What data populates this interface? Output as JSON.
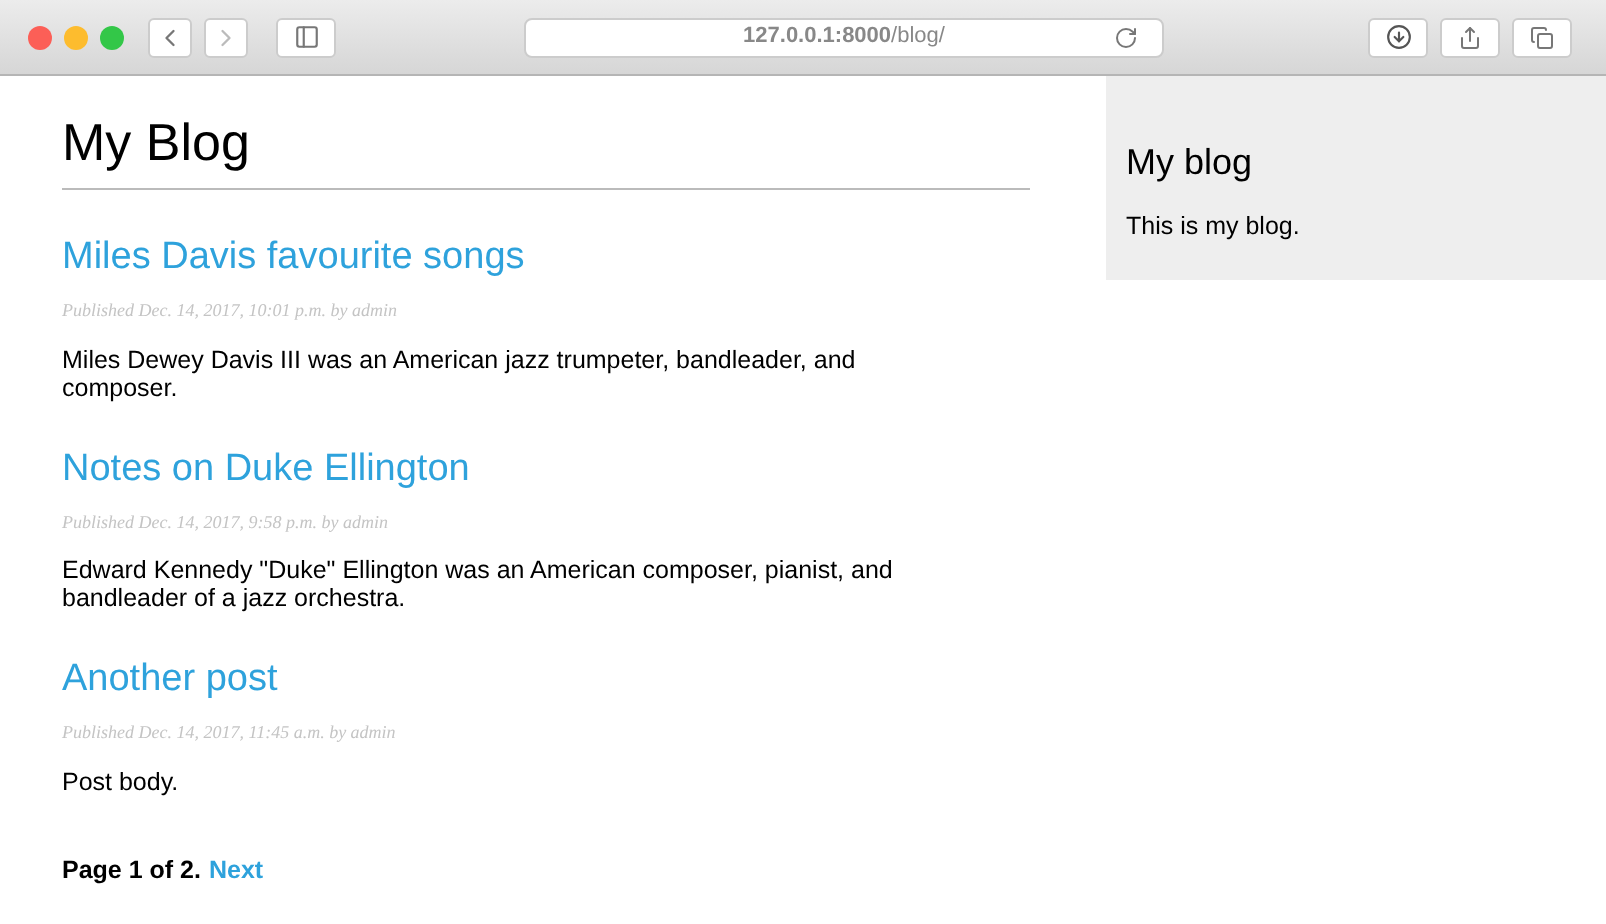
{
  "browser": {
    "url": "**127.0.0.1:8000**/blog/"
  },
  "page": {
    "title": "My Blog",
    "posts": [
      {
        "title": "Miles Davis favourite songs",
        "meta": "Published Dec. 14, 2017, 10:01 p.m. by admin",
        "body": "Miles Dewey Davis III was an American jazz trumpeter, bandleader, and composer."
      },
      {
        "title": "Notes on Duke Ellington",
        "meta": "Published Dec. 14, 2017, 9:58 p.m. by admin",
        "body": "Edward Kennedy \"Duke\" Ellington was an American composer, pianist, and bandleader of a jazz orchestra."
      },
      {
        "title": "Another post",
        "meta": "Published Dec. 14, 2017, 11:45 a.m. by admin",
        "body": "Post body."
      }
    ],
    "pagination": {
      "text": "Page 1 of 2.",
      "next": "Next"
    }
  },
  "sidebar": {
    "title": "My blog",
    "text": "This is my blog."
  }
}
